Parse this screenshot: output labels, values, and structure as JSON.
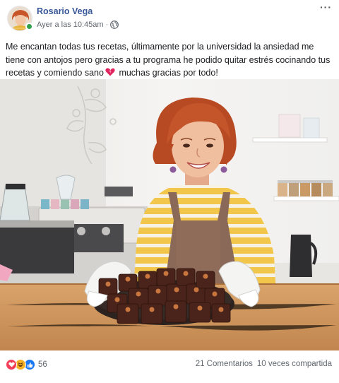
{
  "post": {
    "author": "Rosario Vega",
    "timestamp": "Ayer a las 10:45am",
    "separator": "·",
    "privacy_icon": "globe-icon",
    "more_icon": "more-options-icon",
    "more_label": "···",
    "text_part1": "Me encantan todas tus recetas, últimamente por la universidad la ansiedad me tiene con antojos pero gracias a tu programa he podido quitar estrés cocinando tus recetas y comiendo sano",
    "text_emoji": "broken-heart-emoji",
    "text_part2": " muchas gracias por todo!",
    "image_alt": "Woman holding a tray of chocolate bonbons in a kitchen"
  },
  "footer": {
    "reaction_icons": [
      "love-reaction-icon",
      "haha-reaction-icon",
      "like-reaction-icon"
    ],
    "reaction_count": "56",
    "comments": "21 Comentarios",
    "shares": "10 veces compartida"
  },
  "colors": {
    "author_link": "#385898",
    "meta_gray": "#616770",
    "online_green": "#31a24c",
    "like_blue": "#1877f2",
    "love_red": "#f33e58",
    "haha_yellow": "#f7b125"
  }
}
